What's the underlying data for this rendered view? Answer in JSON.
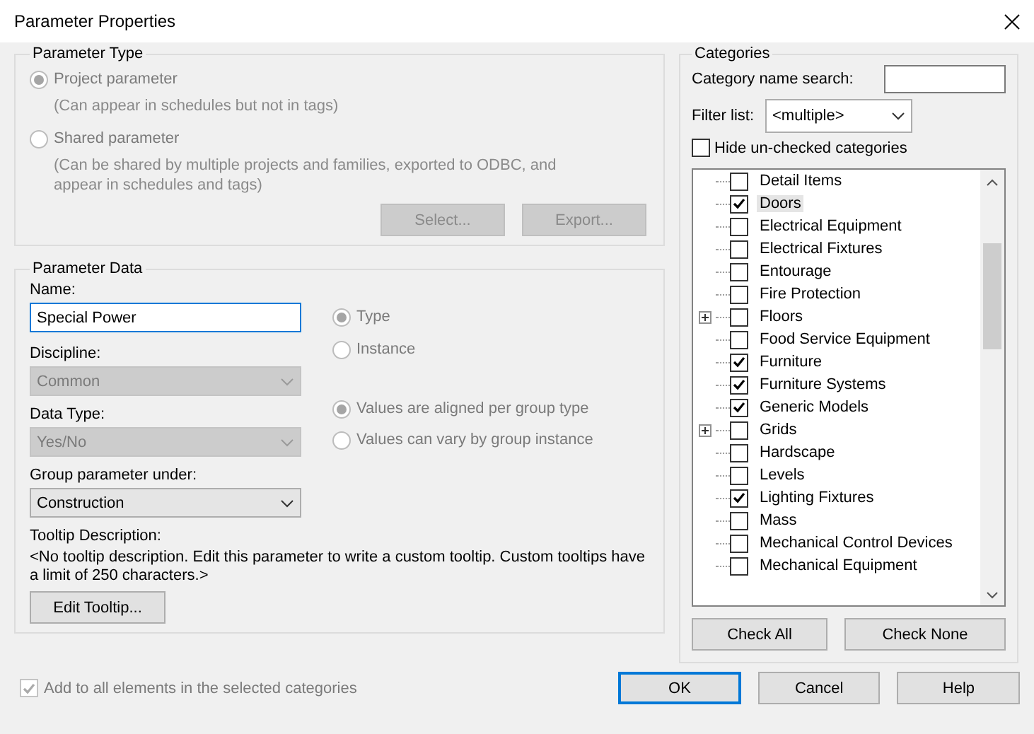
{
  "window": {
    "title": "Parameter Properties"
  },
  "parameter_type": {
    "title": "Parameter Type",
    "disabled": true,
    "options": [
      {
        "label": "Project parameter",
        "note": "(Can appear in schedules but not in tags)",
        "selected": true
      },
      {
        "label": "Shared parameter",
        "note": "(Can be shared by multiple projects and families, exported to ODBC, and appear in schedules and tags)",
        "selected": false
      }
    ],
    "buttons": [
      "Select...",
      "Export..."
    ]
  },
  "parameter_data": {
    "title": "Parameter Data",
    "name": {
      "label": "Name:",
      "value": "Special Power"
    },
    "discipline": {
      "label": "Discipline:",
      "value": "Common",
      "disabled": true
    },
    "data_type": {
      "label": "Data Type:",
      "value": "Yes/No",
      "disabled": true
    },
    "group": {
      "label": "Group parameter under:",
      "value": "Construction",
      "disabled": false
    },
    "scope_options": [
      {
        "label": "Type",
        "selected": true,
        "disabled": true
      },
      {
        "label": "Instance",
        "selected": false,
        "disabled": true
      }
    ],
    "group_options": [
      {
        "label": "Values are aligned per group type",
        "selected": true,
        "disabled": true
      },
      {
        "label": "Values can vary by group instance",
        "selected": false,
        "disabled": true
      }
    ],
    "tooltip_label": "Tooltip Description:",
    "tooltip_text": "<No tooltip description. Edit this parameter to write a custom tooltip. Custom tooltips have a limit of 250 characters.>",
    "edit_tooltip_button": "Edit Tooltip..."
  },
  "add_to_all": {
    "label": "Add to all elements in the selected categories",
    "checked": true,
    "disabled": true
  },
  "categories": {
    "title": "Categories",
    "search_label": "Category name search:",
    "filter_label": "Filter list:",
    "filter_value": "<multiple>",
    "hide_unchecked": {
      "label": "Hide un-checked categories",
      "checked": false
    },
    "items": [
      {
        "label": "Detail Items",
        "checked": false,
        "expandable": false,
        "selected": false
      },
      {
        "label": "Doors",
        "checked": true,
        "expandable": false,
        "selected": true
      },
      {
        "label": "Electrical Equipment",
        "checked": false,
        "expandable": false,
        "selected": false
      },
      {
        "label": "Electrical Fixtures",
        "checked": false,
        "expandable": false,
        "selected": false
      },
      {
        "label": "Entourage",
        "checked": false,
        "expandable": false,
        "selected": false
      },
      {
        "label": "Fire Protection",
        "checked": false,
        "expandable": false,
        "selected": false
      },
      {
        "label": "Floors",
        "checked": false,
        "expandable": true,
        "selected": false
      },
      {
        "label": "Food Service Equipment",
        "checked": false,
        "expandable": false,
        "selected": false
      },
      {
        "label": "Furniture",
        "checked": true,
        "expandable": false,
        "selected": false
      },
      {
        "label": "Furniture Systems",
        "checked": true,
        "expandable": false,
        "selected": false
      },
      {
        "label": "Generic Models",
        "checked": true,
        "expandable": false,
        "selected": false
      },
      {
        "label": "Grids",
        "checked": false,
        "expandable": true,
        "selected": false
      },
      {
        "label": "Hardscape",
        "checked": false,
        "expandable": false,
        "selected": false
      },
      {
        "label": "Levels",
        "checked": false,
        "expandable": false,
        "selected": false
      },
      {
        "label": "Lighting Fixtures",
        "checked": true,
        "expandable": false,
        "selected": false
      },
      {
        "label": "Mass",
        "checked": false,
        "expandable": false,
        "selected": false
      },
      {
        "label": "Mechanical Control Devices",
        "checked": false,
        "expandable": false,
        "selected": false
      },
      {
        "label": "Mechanical Equipment",
        "checked": false,
        "expandable": false,
        "selected": false
      }
    ],
    "buttons": [
      "Check All",
      "Check None"
    ]
  },
  "footer_buttons": [
    {
      "label": "OK",
      "default": true
    },
    {
      "label": "Cancel",
      "default": false
    },
    {
      "label": "Help",
      "default": false
    }
  ]
}
